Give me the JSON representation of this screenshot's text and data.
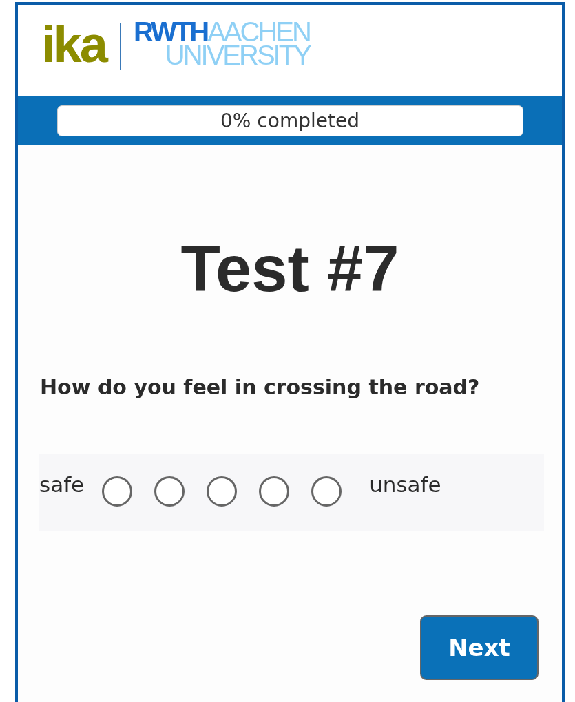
{
  "logo": {
    "ika": "ika",
    "rwth": "RWTH",
    "aachen": "AACHEN",
    "university": "UNIVERSITY"
  },
  "progress": {
    "label": "0% completed",
    "level": 0
  },
  "title": "Test #7",
  "question": "How do you feel in crossing the road?",
  "scale": {
    "left_label": "safe",
    "right_label": "unsafe",
    "options": [
      {
        "selected": false
      },
      {
        "selected": false
      },
      {
        "selected": false
      },
      {
        "selected": false
      },
      {
        "selected": false
      }
    ]
  },
  "buttons": {
    "next": "Next"
  }
}
